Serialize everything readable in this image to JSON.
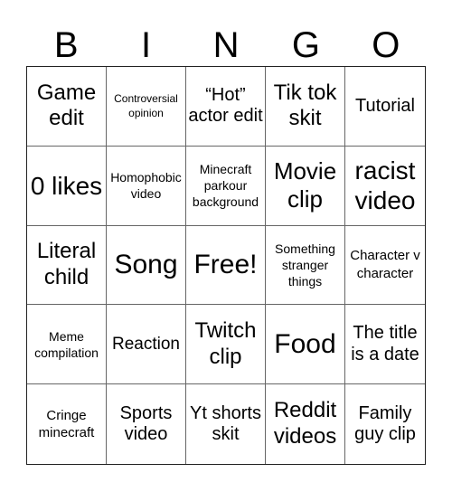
{
  "header": {
    "letters": [
      "B",
      "I",
      "N",
      "G",
      "O"
    ]
  },
  "cells": [
    "Game edit",
    "Controversial opinion",
    "“Hot” actor edit",
    "Tik tok skit",
    "Tutorial",
    "0 likes",
    "Homophobic video",
    "Minecraft parkour background",
    "Movie clip",
    "racist video",
    "Literal child",
    "Song",
    "Free!",
    "Something stranger things",
    "Character v character",
    "Meme compilation",
    "Reaction",
    "Twitch clip",
    "Food",
    "The title is a date",
    "Cringe minecraft",
    "Sports video",
    "Yt shorts skit",
    "Reddit videos",
    "Family guy clip"
  ]
}
